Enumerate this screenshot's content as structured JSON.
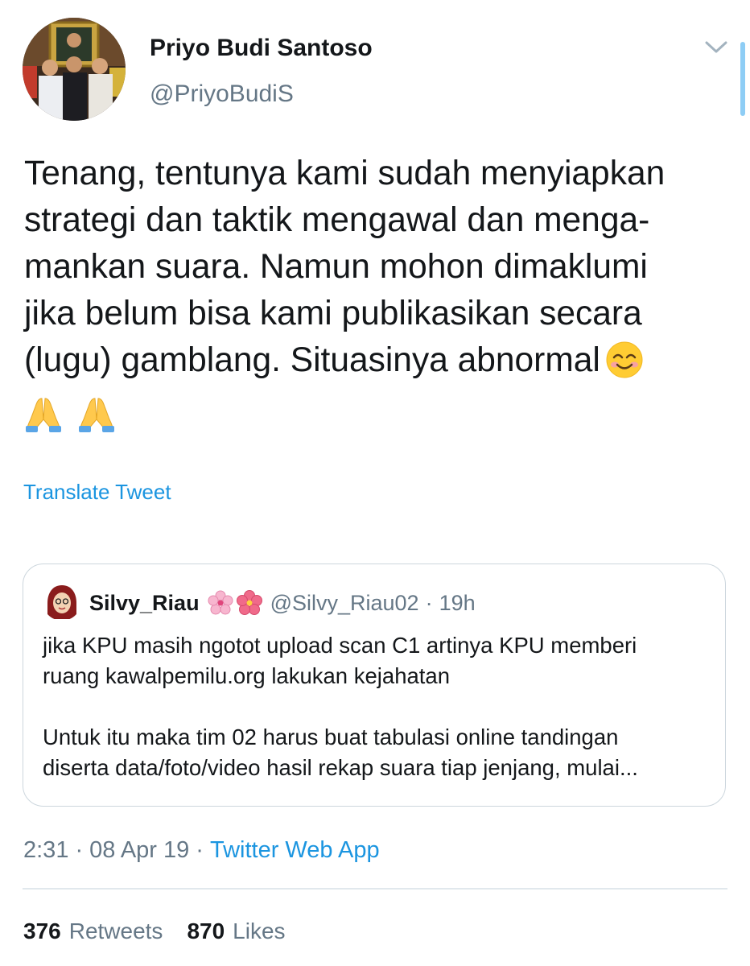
{
  "author": {
    "name": "Priyo Budi Santoso",
    "handle": "@PriyoBudiS"
  },
  "tweet": {
    "lines": [
      "Tenang, tentunya kami sudah menyiapkan",
      "strategi dan taktik mengawal dan menga-",
      "mankan suara. Namun mohon dimaklumi",
      "jika belum bisa kami publikasikan secara",
      "(lugu) gamblang. Situasinya abnormal"
    ],
    "emojis": [
      "smiling-face-with-smiling-eyes",
      "folded-hands",
      "folded-hands"
    ]
  },
  "translate_label": "Translate Tweet",
  "quoted_tweet": {
    "name": "Silvy_Riau",
    "name_emojis": [
      "cherry-blossom",
      "hibiscus"
    ],
    "handle": "@Silvy_Riau02",
    "separator": "·",
    "time": "19h",
    "body_lines": [
      "jika KPU masih ngotot upload scan C1 artinya KPU memberi",
      "ruang kawalpemilu.org lakukan kejahatan",
      "",
      "Untuk itu maka tim 02 harus buat tabulasi online tandingan",
      "diserta data/foto/video hasil rekap suara tiap jenjang, mulai..."
    ]
  },
  "meta": {
    "time": "2:31",
    "separator": "·",
    "date": "08 Apr 19",
    "app": "Twitter Web App"
  },
  "stats": {
    "retweets_count": "376",
    "retweets_label": "Retweets",
    "likes_count": "870",
    "likes_label": "Likes"
  },
  "colors": {
    "text": "#14171a",
    "secondary": "#657786",
    "link": "#1b95e0",
    "border": "#ccd6dd"
  },
  "icons": {
    "caret": "chevron-down-icon"
  }
}
